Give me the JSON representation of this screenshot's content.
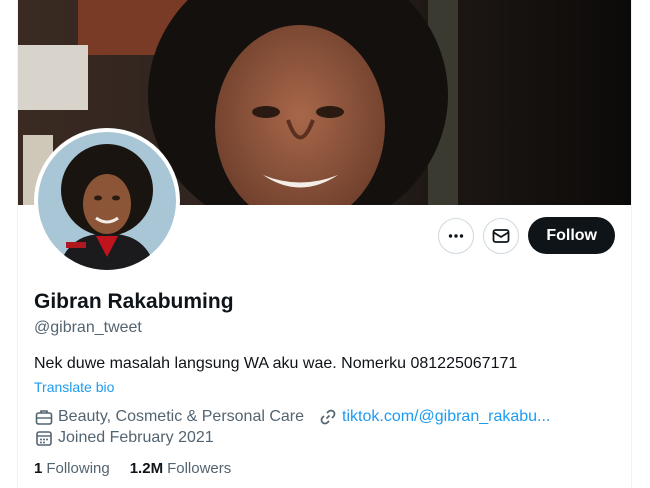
{
  "profile": {
    "name": "Gibran Rakabuming",
    "handle": "@gibran_tweet",
    "bio": "Nek duwe masalah langsung WA aku wae. Nomerku 081225067171",
    "translate_label": "Translate bio",
    "category": "Beauty, Cosmetic & Personal Care",
    "website": "tiktok.com/@gibran_rakabu...",
    "joined": "Joined February 2021",
    "following_count": "1",
    "following_label": "Following",
    "followers_count": "1.2M",
    "followers_label": "Followers"
  },
  "actions": {
    "more_icon": "more-icon",
    "message_icon": "envelope-icon",
    "follow_label": "Follow"
  },
  "icons": {
    "category": "briefcase-icon",
    "website": "link-icon",
    "joined": "calendar-icon"
  },
  "colors": {
    "accent": "#1d9bf0",
    "text": "#0f1419",
    "muted": "#536471",
    "follow_bg": "#0f1419"
  }
}
